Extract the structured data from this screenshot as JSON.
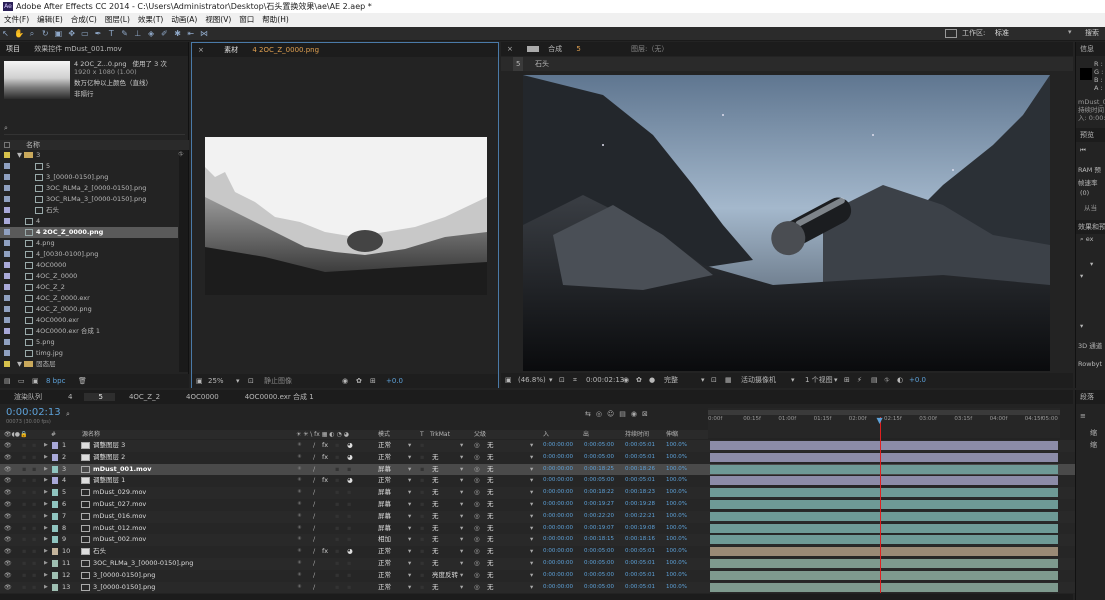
{
  "window": {
    "title": "Adobe After Effects CC 2014 - C:\\Users\\Administrator\\Desktop\\石头置换效果\\ae\\AE 2.aep *",
    "logo": "Ae"
  },
  "menu": [
    "文件(F)",
    "编辑(E)",
    "合成(C)",
    "图层(L)",
    "效果(T)",
    "动画(A)",
    "视图(V)",
    "窗口",
    "帮助(H)"
  ],
  "toolbar": {
    "workspace_label": "工作区:",
    "workspace_value": "标准",
    "search_label": "搜索"
  },
  "project": {
    "tab_project": "项目",
    "tab_effects": "效果控件 mDust_001.mov",
    "preview_name": "4 2OC_Z...0.png",
    "preview_used": "使用了 3 次",
    "preview_dims": "1920 x 1080 (1.00)",
    "preview_note1": "数万亿种以上颜色（直线）",
    "preview_note2": "非隔行",
    "col_name": "名称",
    "items": [
      {
        "label": "3",
        "kind": "folder",
        "indent": 0
      },
      {
        "label": "5",
        "kind": "file",
        "indent": 1
      },
      {
        "label": "3_[0000-0150].png",
        "kind": "file",
        "indent": 1
      },
      {
        "label": "3OC_RLMa_2_[0000-0150].png",
        "kind": "file",
        "indent": 1
      },
      {
        "label": "3OC_RLMa_3_[0000-0150].png",
        "kind": "file",
        "indent": 1
      },
      {
        "label": "石头",
        "kind": "comp",
        "indent": 1
      },
      {
        "label": "4",
        "kind": "comp",
        "indent": 0
      },
      {
        "label": "4 2OC_Z_0000.png",
        "kind": "file",
        "indent": 0,
        "selected": true
      },
      {
        "label": "4.png",
        "kind": "file",
        "indent": 0
      },
      {
        "label": "4_[0030-0100].png",
        "kind": "file",
        "indent": 0
      },
      {
        "label": "4OC0000",
        "kind": "comp",
        "indent": 0
      },
      {
        "label": "4OC_Z_0000",
        "kind": "comp",
        "indent": 0
      },
      {
        "label": "4OC_Z_2",
        "kind": "comp",
        "indent": 0
      },
      {
        "label": "4OC_Z_0000.exr",
        "kind": "file",
        "indent": 0
      },
      {
        "label": "4OC_Z_0000.png",
        "kind": "file",
        "indent": 0
      },
      {
        "label": "4OC0000.exr",
        "kind": "file",
        "indent": 0
      },
      {
        "label": "4OC0000.exr 合成 1",
        "kind": "comp",
        "indent": 0
      },
      {
        "label": "5.png",
        "kind": "file",
        "indent": 0
      },
      {
        "label": "timg.jpg",
        "kind": "file",
        "indent": 0
      },
      {
        "label": "固态层",
        "kind": "folder",
        "indent": 0
      }
    ],
    "bpc": "8 bpc"
  },
  "footage_viewer": {
    "tab_label": "素材",
    "tab_file": "4 2OC_Z_0000.png",
    "zoom": "25%",
    "footer_extra": "静止图像"
  },
  "comp_viewer": {
    "tab_label": "合成",
    "tab_name": "5",
    "layer_tab": "图层:（无）",
    "crumb_num": "5",
    "crumb_name": "石头",
    "zoom": "(46.8%)",
    "timecode": "0:00:02:13",
    "quality": "完整",
    "camera": "活动摄像机",
    "views": "1 个视图",
    "exposure": "+0.0"
  },
  "info_panel": {
    "tab": "信息",
    "r": "R :",
    "g": "G :",
    "b": "B :",
    "a": "A :",
    "layer_line1": "mDust_00",
    "layer_line2": "持续时间",
    "layer_line3": "入: 0:00:0"
  },
  "preview_panel": {
    "tab": "预览",
    "ram": "RAM 预",
    "fps_label": "帧速率",
    "fps_value": "(0)",
    "from_label": "从当"
  },
  "effects_panel": {
    "tab": "效果和预",
    "search": "ex",
    "item1": "3D 通道",
    "item2": "Rowbyt"
  },
  "paragraph_panel": {
    "tab": "段落",
    "item1": "缩",
    "item2": "缩"
  },
  "timeline": {
    "tabs": [
      {
        "label": "渲染队列",
        "active": false
      },
      {
        "label": "4",
        "active": false
      },
      {
        "label": "5",
        "active": true
      },
      {
        "label": "4OC_Z_2",
        "active": false
      },
      {
        "label": "4OC0000",
        "active": false
      },
      {
        "label": "4OC0000.exr 合成 1",
        "active": false
      }
    ],
    "timecode": "0:00:02:13",
    "timecode_sub": "00073 (30.00 fps)",
    "headers": {
      "num": "#",
      "source": "源名称",
      "mode": "模式",
      "t": "T",
      "trkmat": "TrkMat",
      "parent": "父级",
      "in": "入",
      "out": "出",
      "duration": "持续时间",
      "stretch": "伸缩"
    },
    "ruler": [
      "0:00f",
      "00:15f",
      "01:00f",
      "01:15f",
      "02:00f",
      "02:15f",
      "03:00f",
      "03:15f",
      "04:00f",
      "04:15f",
      "05:00"
    ],
    "playhead_pct": 49,
    "layers": [
      {
        "num": "1",
        "name": "调整图层 3",
        "mode": "正常",
        "trk": "",
        "parent": "无",
        "in": "0:00:00:00",
        "out": "0:00:05:00",
        "dur": "0:00:05:01",
        "stretch": "100.0%",
        "bar": "#8c8ca8",
        "label": "#a8a8d8",
        "fx": true,
        "bar_start": 0,
        "bar_end": 1
      },
      {
        "num": "2",
        "name": "调整图层 2",
        "mode": "正常",
        "trk": "无",
        "parent": "无",
        "in": "0:00:00:00",
        "out": "0:00:05:00",
        "dur": "0:00:05:01",
        "stretch": "100.0%",
        "bar": "#8c8ca8",
        "label": "#a8a8d8",
        "fx": true,
        "bar_start": 0,
        "bar_end": 1
      },
      {
        "num": "3",
        "name": "mDust_001.mov",
        "mode": "屏幕",
        "trk": "无",
        "parent": "无",
        "in": "0:00:00:00",
        "out": "0:00:18:25",
        "dur": "0:00:18:26",
        "stretch": "100.0%",
        "bar": "#6e9a96",
        "label": "#8fc4bf",
        "fx": false,
        "selected": true,
        "bar_start": 0,
        "bar_end": 1
      },
      {
        "num": "4",
        "name": "调整图层 1",
        "mode": "正常",
        "trk": "无",
        "parent": "无",
        "in": "0:00:00:00",
        "out": "0:00:05:00",
        "dur": "0:00:05:01",
        "stretch": "100.0%",
        "bar": "#8c8ca8",
        "label": "#a8a8d8",
        "fx": true,
        "bar_start": 0,
        "bar_end": 1
      },
      {
        "num": "5",
        "name": "mDust_029.mov",
        "mode": "屏幕",
        "trk": "无",
        "parent": "无",
        "in": "0:00:00:00",
        "out": "0:00:18:22",
        "dur": "0:00:18:23",
        "stretch": "100.0%",
        "bar": "#6e9a96",
        "label": "#8fc4bf",
        "fx": false,
        "bar_start": 0,
        "bar_end": 1
      },
      {
        "num": "6",
        "name": "mDust_027.mov",
        "mode": "屏幕",
        "trk": "无",
        "parent": "无",
        "in": "0:00:00:00",
        "out": "0:00:19:27",
        "dur": "0:00:19:28",
        "stretch": "100.0%",
        "bar": "#6e9a96",
        "label": "#8fc4bf",
        "fx": false,
        "bar_start": 0,
        "bar_end": 1
      },
      {
        "num": "7",
        "name": "mDust_016.mov",
        "mode": "屏幕",
        "trk": "无",
        "parent": "无",
        "in": "0:00:00:00",
        "out": "0:00:22:20",
        "dur": "0:00:22:21",
        "stretch": "100.0%",
        "bar": "#6e9a96",
        "label": "#8fc4bf",
        "fx": false,
        "bar_start": 0,
        "bar_end": 1
      },
      {
        "num": "8",
        "name": "mDust_012.mov",
        "mode": "屏幕",
        "trk": "无",
        "parent": "无",
        "in": "0:00:00:00",
        "out": "0:00:19:07",
        "dur": "0:00:19:08",
        "stretch": "100.0%",
        "bar": "#6e9a96",
        "label": "#8fc4bf",
        "fx": false,
        "bar_start": 0,
        "bar_end": 1
      },
      {
        "num": "9",
        "name": "mDust_002.mov",
        "mode": "相加",
        "trk": "无",
        "parent": "无",
        "in": "0:00:00:00",
        "out": "0:00:18:15",
        "dur": "0:00:18:16",
        "stretch": "100.0%",
        "bar": "#6e9a96",
        "label": "#8fc4bf",
        "fx": false,
        "bar_start": 0,
        "bar_end": 1
      },
      {
        "num": "10",
        "name": "石头",
        "mode": "正常",
        "trk": "无",
        "parent": "无",
        "in": "0:00:00:00",
        "out": "0:00:05:00",
        "dur": "0:00:05:01",
        "stretch": "100.0%",
        "bar": "#9a8a76",
        "label": "#c4b49c",
        "fx": true,
        "bar_start": 0,
        "bar_end": 1
      },
      {
        "num": "11",
        "name": "3OC_RLMa_3_[0000-0150].png",
        "mode": "正常",
        "trk": "无",
        "parent": "无",
        "in": "0:00:00:00",
        "out": "0:00:05:00",
        "dur": "0:00:05:01",
        "stretch": "100.0%",
        "bar": "#7e9a8e",
        "label": "#9fbfb2",
        "fx": false,
        "bar_start": 0,
        "bar_end": 1
      },
      {
        "num": "12",
        "name": "3_[0000-0150].png",
        "mode": "正常",
        "trk": "亮度反转",
        "parent": "无",
        "in": "0:00:00:00",
        "out": "0:00:05:00",
        "dur": "0:00:05:01",
        "stretch": "100.0%",
        "bar": "#7e9a8e",
        "label": "#9fbfb2",
        "fx": false,
        "bar_start": 0,
        "bar_end": 1
      },
      {
        "num": "13",
        "name": "3_[0000-0150].png",
        "mode": "正常",
        "trk": "无",
        "parent": "无",
        "in": "0:00:00:00",
        "out": "0:00:05:00",
        "dur": "0:00:05:01",
        "stretch": "100.0%",
        "bar": "#7e9a8e",
        "label": "#9fbfb2",
        "fx": false,
        "bar_start": 0,
        "bar_end": 1
      }
    ]
  }
}
